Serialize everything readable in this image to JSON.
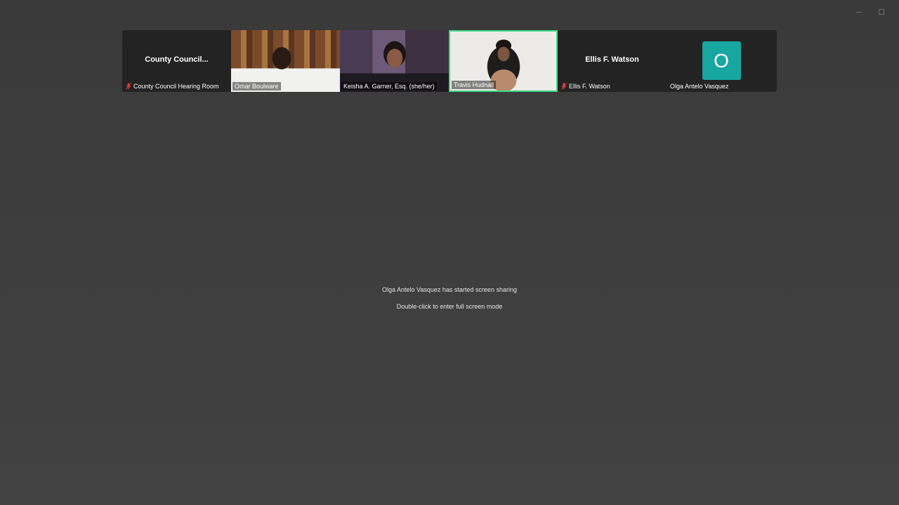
{
  "participants": [
    {
      "display_name": "County  Council...",
      "label": "County Council Hearing Room",
      "muted": true
    },
    {
      "label": "Omar Boulware",
      "muted": false
    },
    {
      "label": "Keisha A. Garner, Esq. (she/her)",
      "muted": false
    },
    {
      "label": "Travis Hudnall",
      "muted": false,
      "active_speaker": true
    },
    {
      "display_name": "Ellis F. Watson",
      "label": "Ellis F. Watson",
      "muted": true
    },
    {
      "avatar_letter": "O",
      "label": "Olga Antelo Vasquez",
      "muted": false
    }
  ],
  "share_notice": {
    "line1": "Olga Antelo Vasquez has started screen sharing",
    "line2": "Double-click to enter full screen mode"
  },
  "colors": {
    "active_speaker_border": "#3ddc84",
    "avatar_bg": "#17a7a0",
    "mute_icon": "#e0413b"
  }
}
